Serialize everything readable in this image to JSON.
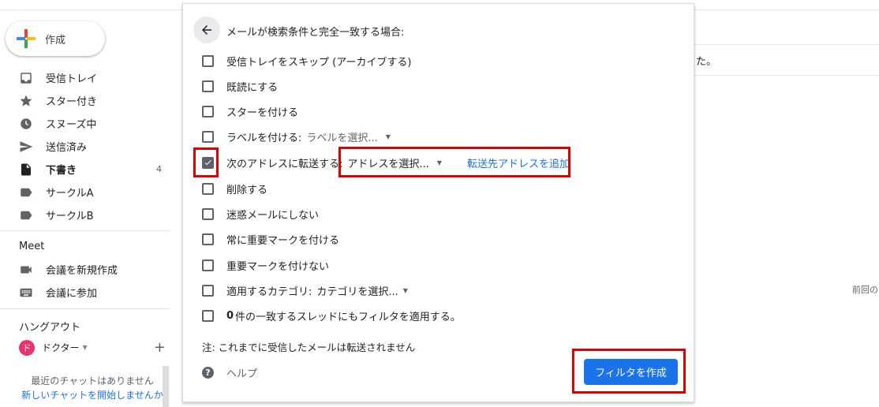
{
  "sidebar": {
    "compose_label": "作成",
    "items": [
      {
        "label": "受信トレイ",
        "icon": "inbox-icon"
      },
      {
        "label": "スター付き",
        "icon": "star-icon"
      },
      {
        "label": "スヌーズ中",
        "icon": "clock-icon"
      },
      {
        "label": "送信済み",
        "icon": "send-icon"
      },
      {
        "label": "下書き",
        "icon": "draft-icon",
        "count": "4"
      },
      {
        "label": "サークルA",
        "icon": "label-icon"
      },
      {
        "label": "サークルB",
        "icon": "label-icon"
      }
    ],
    "meet": {
      "title": "Meet",
      "items": [
        {
          "label": "会議を新規作成",
          "icon": "video-icon"
        },
        {
          "label": "会議に参加",
          "icon": "keyboard-icon"
        }
      ]
    },
    "hangouts": {
      "title": "ハングアウト",
      "user_initial": "ド",
      "user_name": "ドクター",
      "add_label": "+",
      "no_chats": "最近のチャットはありません",
      "start_chat_link": "新しいチャットを開始しませんか"
    }
  },
  "background": {
    "text_ta": "た。",
    "text_prev": "前回の"
  },
  "dialog": {
    "header": "メールが検索条件と完全一致する場合:",
    "options": [
      {
        "label": "受信トレイをスキップ (アーカイブする)",
        "checked": false
      },
      {
        "label": "既読にする",
        "checked": false
      },
      {
        "label": "スターを付ける",
        "checked": false
      },
      {
        "label": "ラベルを付ける:",
        "checked": false,
        "select": "ラベルを選択..."
      },
      {
        "label": "次のアドレスに転送する:",
        "checked": true,
        "select": "アドレスを選択...",
        "link": "転送先アドレスを追加"
      },
      {
        "label": "削除する",
        "checked": false
      },
      {
        "label": "迷惑メールにしない",
        "checked": false
      },
      {
        "label": "常に重要マークを付ける",
        "checked": false
      },
      {
        "label": "重要マークを付けない",
        "checked": false
      },
      {
        "label": "適用するカテゴリ:",
        "checked": false,
        "select": "カテゴリを選択..."
      },
      {
        "count": "0",
        "label": "件の一致するスレッドにもフィルタを適用する。",
        "checked": false
      }
    ],
    "note": "注: これまでに受信したメールは転送されません",
    "help_label": "ヘルプ",
    "create_button": "フィルタを作成"
  },
  "colors": {
    "accent": "#1a73e8",
    "highlight": "#e00000",
    "avatar": "#e8336b"
  }
}
